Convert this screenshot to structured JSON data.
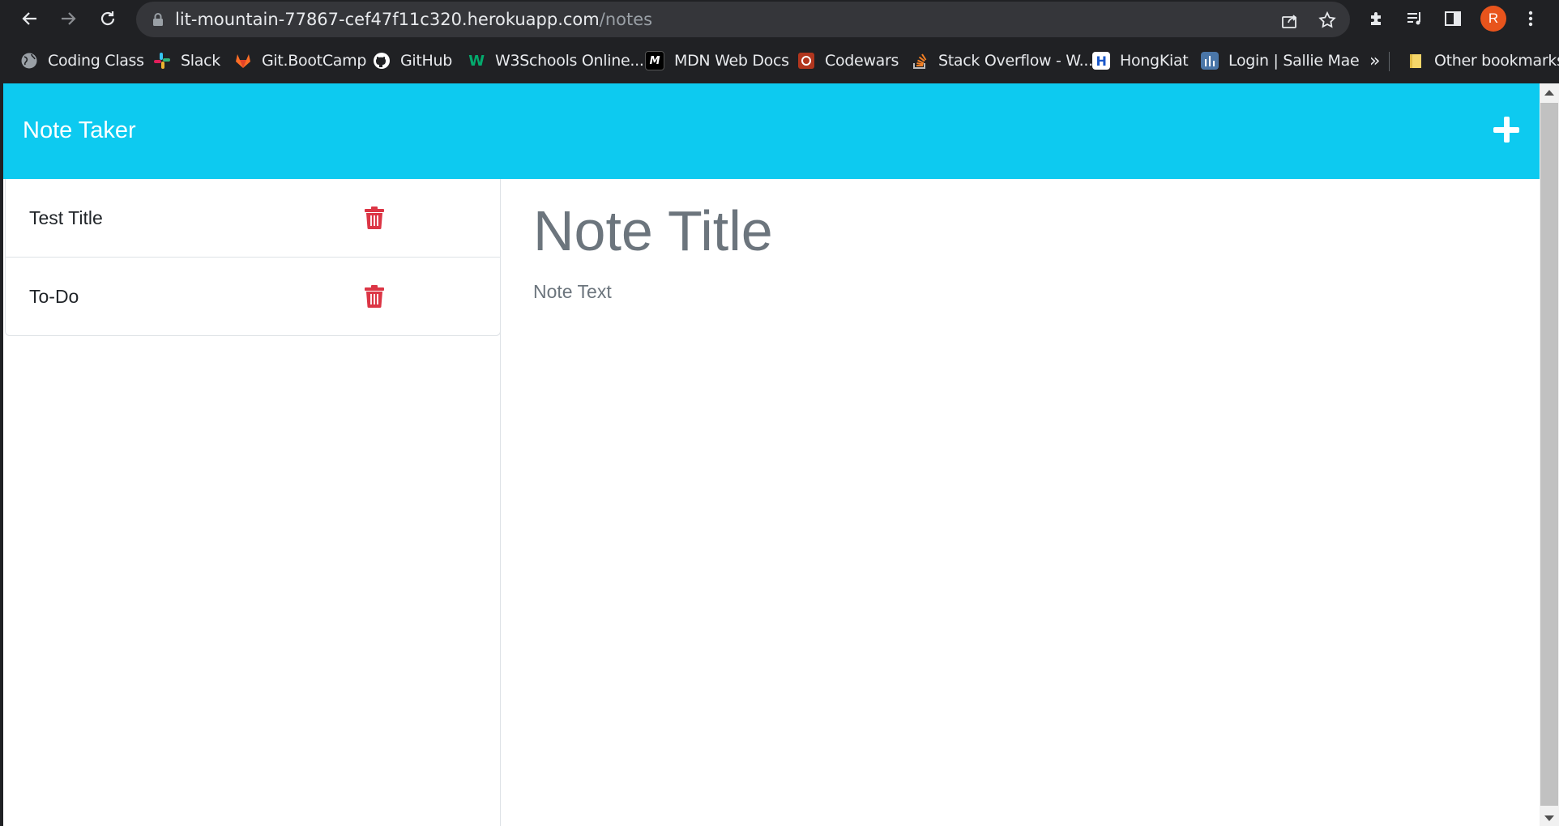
{
  "browser": {
    "url_host": "lit-mountain-77867-cef47f11c320.herokuapp.com",
    "url_path": "/notes",
    "profile_initial": "R",
    "bookmarks": [
      {
        "label": "Coding Class",
        "icon": "globe-icon",
        "color": "#9aa0a6"
      },
      {
        "label": "Slack",
        "icon": "slack-icon",
        "color": "#e01e5a"
      },
      {
        "label": "Git.BootCamp",
        "icon": "gitlab-icon",
        "color": "#fc6d26"
      },
      {
        "label": "GitHub",
        "icon": "github-icon",
        "color": "#ffffff"
      },
      {
        "label": "W3Schools Online...",
        "icon": "w3schools-icon",
        "color": "#04aa6d"
      },
      {
        "label": "MDN Web Docs",
        "icon": "mdn-icon",
        "color": "#000000"
      },
      {
        "label": "Codewars",
        "icon": "codewars-icon",
        "color": "#b1361e"
      },
      {
        "label": "Stack Overflow - W...",
        "icon": "stackoverflow-icon",
        "color": "#f48024"
      },
      {
        "label": "HongKiat",
        "icon": "hongkiat-icon",
        "color": "#1a57c9"
      },
      {
        "label": "Login | Sallie Mae",
        "icon": "salliemae-icon",
        "color": "#4a76a8"
      }
    ],
    "overflow_label": "»",
    "other_bookmarks": "Other bookmarks"
  },
  "app": {
    "brand": "Note Taker",
    "accent": "#0dcaf0",
    "delete_color": "#dc3545",
    "notes": [
      {
        "title": "Test Title"
      },
      {
        "title": "To-Do"
      }
    ],
    "editor": {
      "title_placeholder": "Note Title",
      "text_placeholder": "Note Text"
    }
  }
}
